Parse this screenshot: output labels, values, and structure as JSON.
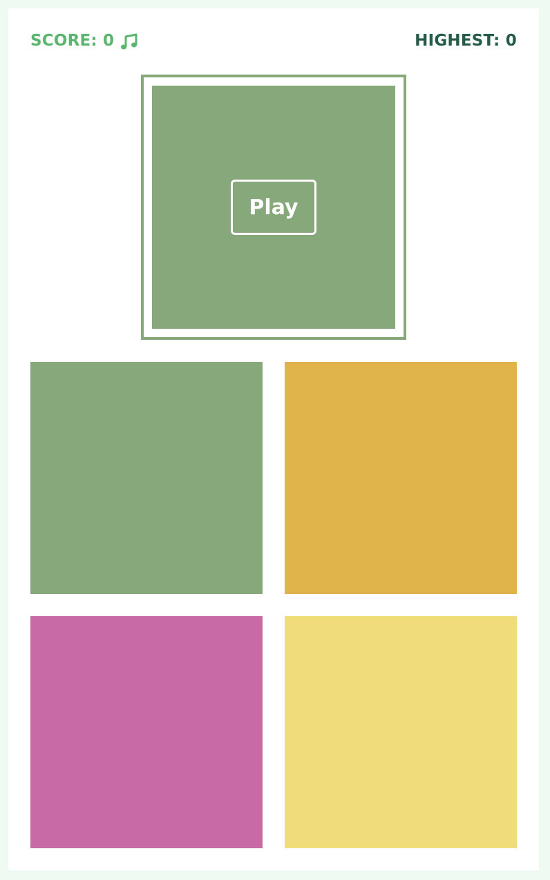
{
  "header": {
    "score_text": "SCORE: 0",
    "highest_text": "HIGHEST: 0",
    "music_icon": "music-note-icon"
  },
  "display": {
    "play_label": "Play",
    "color": "#86a87a"
  },
  "pads": [
    {
      "id": "pad-1",
      "color": "#86a87a"
    },
    {
      "id": "pad-2",
      "color": "#e1b34b"
    },
    {
      "id": "pad-3",
      "color": "#c86aa5"
    },
    {
      "id": "pad-4",
      "color": "#f1dc7c"
    }
  ],
  "colors": {
    "background": "#effaf3",
    "card": "#ffffff",
    "score_text": "#5ab56e",
    "highest_text": "#255c47",
    "frame_border": "#86a87a"
  }
}
